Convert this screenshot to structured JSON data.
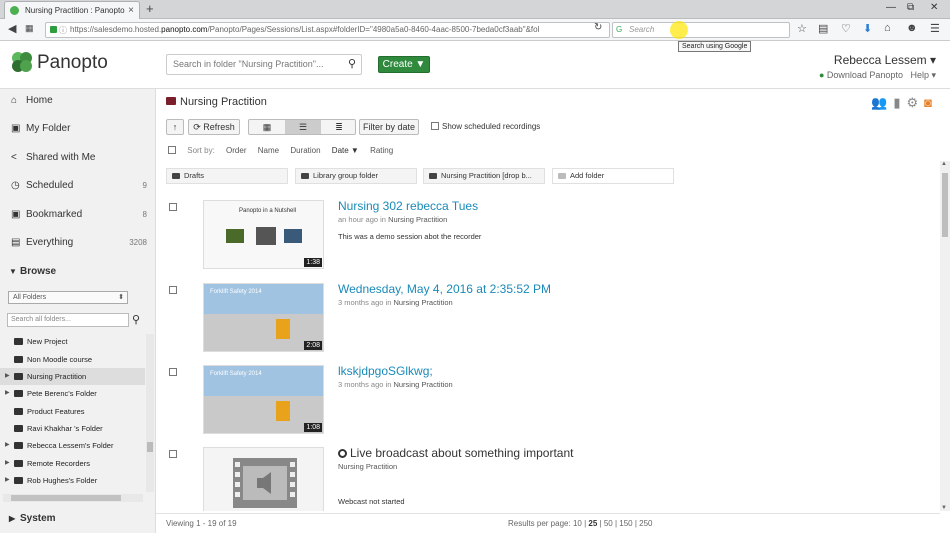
{
  "browser": {
    "tab_title": "Nursing Practition : Panopto",
    "tab_close": "×",
    "new_tab": "+",
    "url_prefix": "https://salesdemo.hosted.",
    "url_domain": "panopto.com",
    "url_rest": "/Panopto/Pages/Sessions/List.aspx#folderID=\"4980a5a0-8460-4aac-8500-7beda0cf3aab\"&fol",
    "search_placeholder": "Search",
    "tooltip": "Search using Google",
    "icon_names": [
      "back-icon",
      "info-icon",
      "lock-icon",
      "reload-icon",
      "bookmark-star-icon",
      "reading-list-icon",
      "pocket-icon",
      "download-icon",
      "home-icon",
      "sync-icon",
      "menu-icon",
      "minimize-icon",
      "restore-icon",
      "close-icon"
    ]
  },
  "header": {
    "logo_text": "Panopto",
    "folder_search_placeholder": "Search in folder \"Nursing Practition\"...",
    "create_label": "Create ▼",
    "user_name": "Rebecca Lessem ▾",
    "download_link": "Download Panopto",
    "help_link": "Help ▾",
    "brand_green": "#2f8a3e"
  },
  "sidebar": {
    "nav": [
      {
        "label": "Home",
        "icon": "home-icon",
        "count": ""
      },
      {
        "label": "My Folder",
        "icon": "folder-icon",
        "count": ""
      },
      {
        "label": "Shared with Me",
        "icon": "share-icon",
        "count": ""
      },
      {
        "label": "Scheduled",
        "icon": "clock-icon",
        "count": "9"
      },
      {
        "label": "Bookmarked",
        "icon": "bookmark-icon",
        "count": "8"
      },
      {
        "label": "Everything",
        "icon": "stack-icon",
        "count": "3208"
      }
    ],
    "browse_label": "Browse",
    "folder_filter": "All Folders",
    "folder_search_placeholder": "Search all folders...",
    "folders": [
      {
        "name": "New Project",
        "expandable": false
      },
      {
        "name": "Non Moodle course",
        "expandable": false
      },
      {
        "name": "Nursing Practition",
        "expandable": true,
        "selected": true
      },
      {
        "name": "Pete Berenc's Folder",
        "expandable": true
      },
      {
        "name": "Product Features",
        "expandable": false
      },
      {
        "name": "Ravi Khakhar 's Folder",
        "expandable": false
      },
      {
        "name": "Rebecca Lessem's Folder",
        "expandable": true
      },
      {
        "name": "Remote Recorders",
        "expandable": true
      },
      {
        "name": "Rob Hughes's Folder",
        "expandable": true
      }
    ],
    "system_label": "System"
  },
  "main": {
    "breadcrumb": "Nursing Practition",
    "toolbar": {
      "up_label": "↑",
      "refresh_label": "⟳ Refresh",
      "filter_label": "Filter by date",
      "scheduled_label": "Show scheduled recordings"
    },
    "sort": {
      "label": "Sort by:",
      "options": [
        "Order",
        "Name",
        "Duration",
        "Date ▼",
        "Rating"
      ]
    },
    "folders": [
      {
        "name": "Drafts"
      },
      {
        "name": "Library group folder"
      },
      {
        "name": "Nursing Practition [drop b..."
      },
      {
        "name": "Add folder"
      }
    ],
    "sessions": [
      {
        "title": "Nursing 302 rebecca Tues",
        "when": "an hour ago in",
        "folder": "Nursing Practition",
        "desc": "This was a demo session abot the recorder",
        "duration": "1:38",
        "thumb_type": "slide",
        "thumb_caption": "Panopto in a Nutshell"
      },
      {
        "title": "Wednesday, May 4, 2016 at 2:35:52 PM",
        "when": "3 months ago in",
        "folder": "Nursing Practition",
        "desc": "",
        "duration": "2:08",
        "thumb_type": "forklift",
        "thumb_caption": "Forklift Safety 2014"
      },
      {
        "title": "lkskjdpgoSGlkwg;",
        "when": "3 months ago in",
        "folder": "Nursing Practition",
        "desc": "",
        "duration": "1:08",
        "thumb_type": "forklift",
        "thumb_caption": "Forklift Safety 2014"
      },
      {
        "title": "Live broadcast about something important",
        "when": "",
        "folder": "Nursing Practition",
        "desc": "Webcast not started",
        "duration": "",
        "thumb_type": "film",
        "thumb_caption": ""
      }
    ],
    "footer": {
      "viewing": "Viewing 1 - 19 of 19",
      "per_page_label": "Results per page:",
      "per_page_options": [
        "10",
        "25",
        "50",
        "150",
        "250"
      ],
      "per_page_current": "25"
    }
  }
}
